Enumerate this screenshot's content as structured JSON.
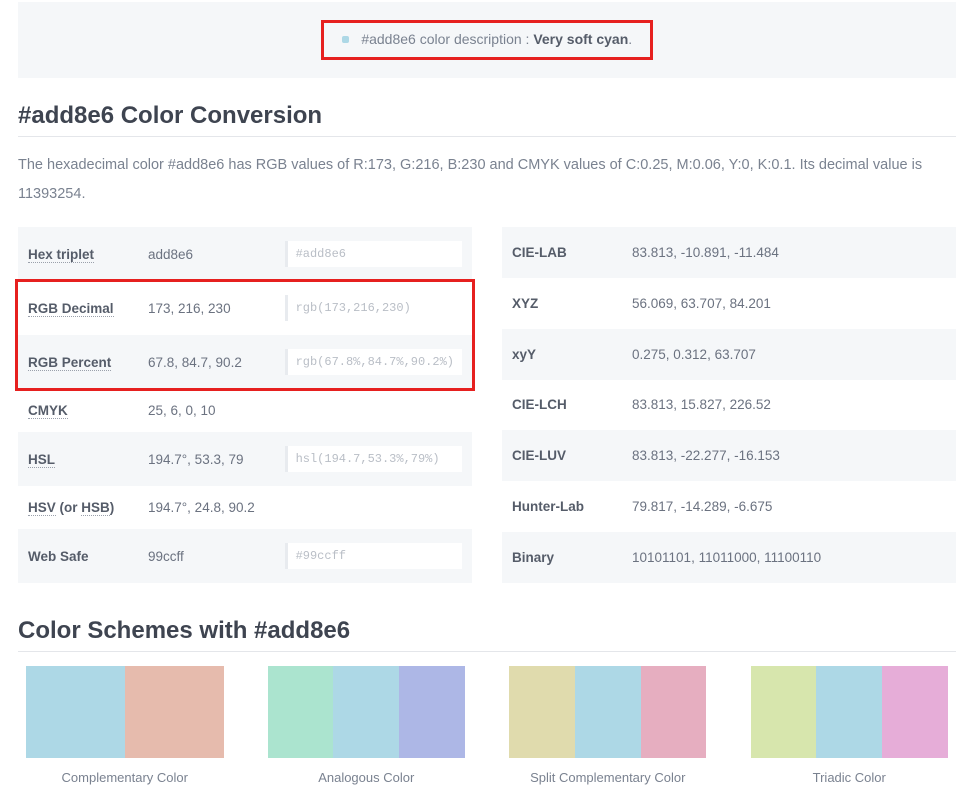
{
  "description": {
    "prefix": "#add8e6 color description : ",
    "name": "Very soft cyan",
    "suffix": "."
  },
  "headings": {
    "conversion": "#add8e6 Color Conversion",
    "schemes": "Color Schemes with #add8e6"
  },
  "intro": "The hexadecimal color #add8e6 has RGB values of R:173, G:216, B:230 and CMYK values of C:0.25, M:0.06, Y:0, K:0.1. Its decimal value is 11393254.",
  "left_rows": [
    {
      "label": "Hex triplet",
      "value": "add8e6",
      "code": "#add8e6",
      "dotted": true
    },
    {
      "label": "RGB Decimal",
      "value": "173, 216, 230",
      "code": "rgb(173,216,230)",
      "dotted": true
    },
    {
      "label": "RGB Percent",
      "value": "67.8, 84.7, 90.2",
      "code": "rgb(67.8%,84.7%,90.2%)",
      "dotted": true
    },
    {
      "label": "CMYK",
      "value": "25, 6, 0, 10",
      "code": "",
      "dotted": true
    },
    {
      "label": "HSL",
      "value": "194.7°, 53.3, 79",
      "code": "hsl(194.7,53.3%,79%)",
      "dotted": true
    },
    {
      "label_html": "<span class='dotted'>HSV</span> (or <span class='dotted'>HSB</span>)",
      "value": "194.7°, 24.8, 90.2",
      "code": ""
    },
    {
      "label": "Web Safe",
      "value": "99ccff",
      "code": "#99ccff",
      "dotted": false
    }
  ],
  "right_rows": [
    {
      "label": "CIE-LAB",
      "value": "83.813, -10.891, -11.484"
    },
    {
      "label": "XYZ",
      "value": "56.069, 63.707, 84.201"
    },
    {
      "label": "xyY",
      "value": "0.275, 0.312, 63.707"
    },
    {
      "label": "CIE-LCH",
      "value": "83.813, 15.827, 226.52"
    },
    {
      "label": "CIE-LUV",
      "value": "83.813, -22.277, -16.153"
    },
    {
      "label": "Hunter-Lab",
      "value": "79.817, -14.289, -6.675"
    },
    {
      "label": "Binary",
      "value": "10101101, 11011000, 11100110"
    }
  ],
  "schemes": [
    {
      "label": "Complementary Color",
      "colors": [
        "#add8e6",
        "#e6bbad"
      ]
    },
    {
      "label": "Analogous Color",
      "colors": [
        "#abe4cf",
        "#add8e6",
        "#adb7e6"
      ]
    },
    {
      "label": "Split Complementary Color",
      "colors": [
        "#e0dbad",
        "#add8e6",
        "#e6aec0"
      ]
    },
    {
      "label": "Triadic Color",
      "colors": [
        "#d7e6ad",
        "#add8e6",
        "#e6add8"
      ]
    }
  ]
}
